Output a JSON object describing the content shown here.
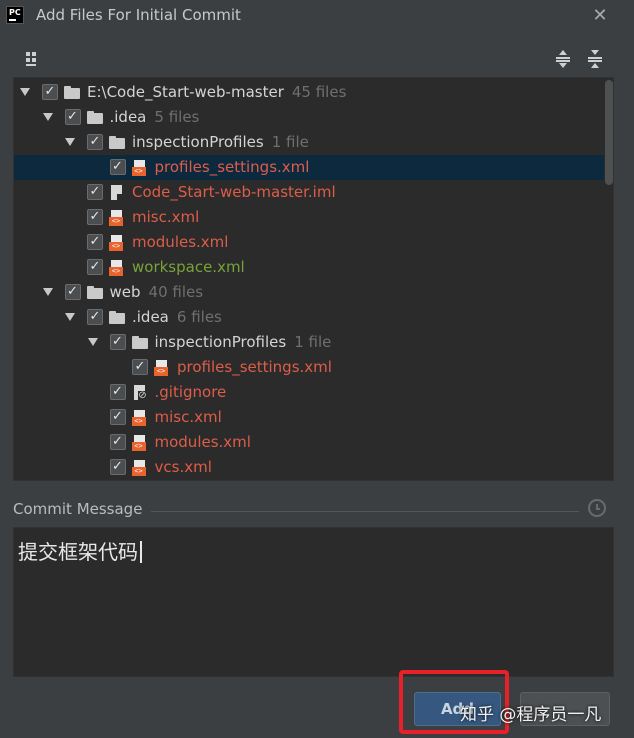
{
  "window": {
    "app_icon_label": "PC",
    "title": "Add Files For Initial Commit",
    "close_glyph": "✕"
  },
  "tree": {
    "rows": [
      {
        "label": "E:\\Code_Start-web-master",
        "count": "45 files",
        "type": "folder",
        "color": "white",
        "expanded": true
      },
      {
        "label": ".idea",
        "count": "5 files",
        "type": "folder",
        "color": "white",
        "expanded": true
      },
      {
        "label": "inspectionProfiles",
        "count": "1 file",
        "type": "folder",
        "color": "white",
        "expanded": true
      },
      {
        "label": "profiles_settings.xml",
        "type": "xml",
        "color": "red",
        "selected": true
      },
      {
        "label": "Code_Start-web-master.iml",
        "type": "iml",
        "color": "red"
      },
      {
        "label": "misc.xml",
        "type": "xml",
        "color": "red"
      },
      {
        "label": "modules.xml",
        "type": "xml",
        "color": "red"
      },
      {
        "label": "workspace.xml",
        "type": "xml",
        "color": "green"
      },
      {
        "label": "web",
        "count": "40 files",
        "type": "folder",
        "color": "white",
        "expanded": true
      },
      {
        "label": ".idea",
        "count": "6 files",
        "type": "folder",
        "color": "white",
        "expanded": true
      },
      {
        "label": "inspectionProfiles",
        "count": "1 file",
        "type": "folder",
        "color": "white",
        "expanded": true
      },
      {
        "label": "profiles_settings.xml",
        "type": "xml",
        "color": "red"
      },
      {
        "label": ".gitignore",
        "type": "gitignore",
        "color": "red"
      },
      {
        "label": "misc.xml",
        "type": "xml",
        "color": "red"
      },
      {
        "label": "modules.xml",
        "type": "xml",
        "color": "red"
      },
      {
        "label": "vcs.xml",
        "type": "xml",
        "color": "red"
      }
    ]
  },
  "commit": {
    "label": "Commit Message",
    "message": "提交框架代码"
  },
  "buttons": {
    "add_label": "Add"
  },
  "watermark": "知乎 @程序员一凡",
  "colors": {
    "background": "#3c3f41",
    "panel": "#2b2b2b",
    "selection": "#0d293e",
    "new_file_red": "#dd5d49",
    "modified_green": "#77a33a",
    "primary_button": "#365880",
    "highlight": "#e8202a"
  }
}
